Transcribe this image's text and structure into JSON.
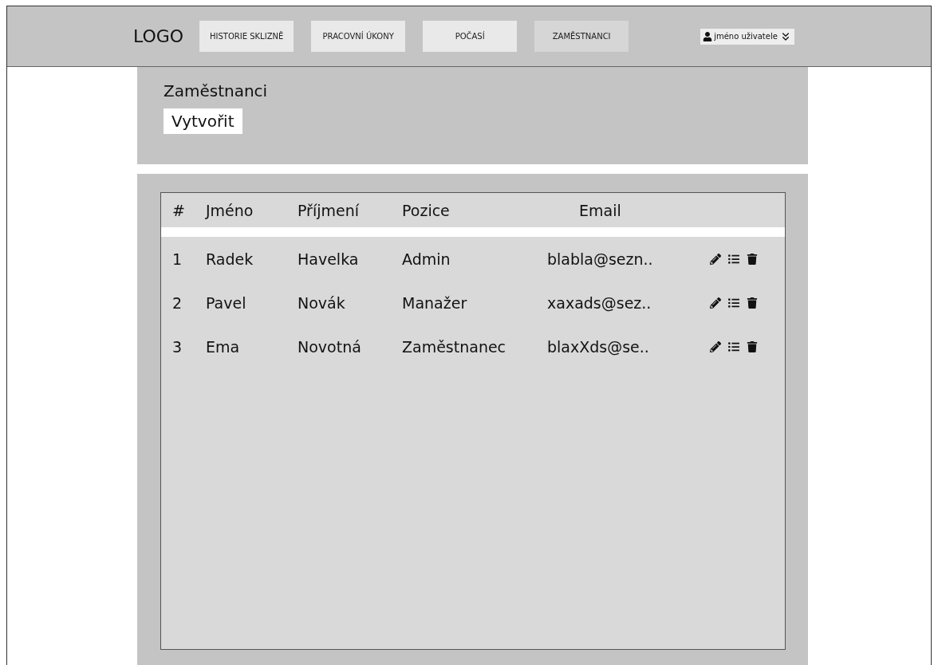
{
  "header": {
    "logo": "LOGO",
    "nav": [
      {
        "label": "HISTORIE SKLIZNĚ",
        "selected": false
      },
      {
        "label": "PRACOVNÍ ÚKONY",
        "selected": false
      },
      {
        "label": "POČASÍ",
        "selected": false
      },
      {
        "label": "ZAMĚSTNANCI",
        "selected": true
      }
    ],
    "user": "jméno uživatele"
  },
  "page": {
    "title": "Zaměstnanci",
    "create_button": "Vytvořit"
  },
  "table": {
    "columns": [
      "#",
      "Jméno",
      "Příjmení",
      "Pozice",
      "Email"
    ],
    "rows": [
      [
        "1",
        "Radek",
        "Havelka",
        "Admin",
        "blabla@sezn.."
      ],
      [
        "2",
        "Pavel",
        "Novák",
        "Manažer",
        "xaxads@sez.."
      ],
      [
        "3",
        "Ema",
        "Novotná",
        "Zaměstnanec",
        "blaxXds@se.."
      ]
    ]
  }
}
